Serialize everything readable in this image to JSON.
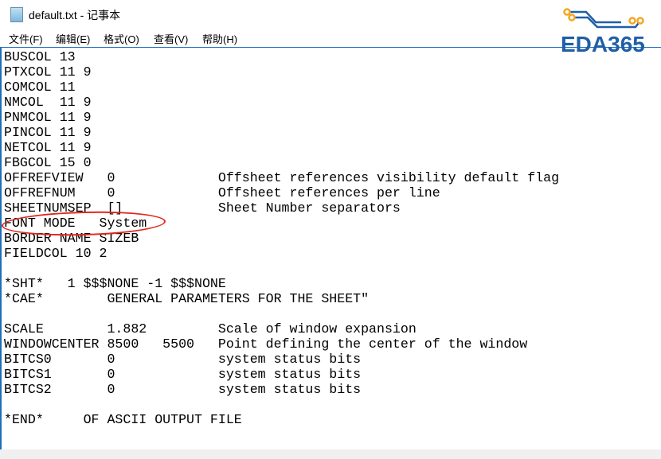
{
  "window": {
    "title": "default.txt - 记事本"
  },
  "menu": [
    "文件(F)",
    "编辑(E)",
    "格式(O)",
    "查看(V)",
    "帮助(H)"
  ],
  "logo": {
    "text": "EDA365",
    "accent": "#f5a623",
    "brand": "#1f5fa8"
  },
  "annotation_color": "#e0261d",
  "lines": [
    "BUSCOL 13",
    "PTXCOL 11 9",
    "COMCOL 11",
    "NMCOL  11 9",
    "PNMCOL 11 9",
    "PINCOL 11 9",
    "NETCOL 11 9",
    "FBGCOL 15 0",
    "OFFREFVIEW   0             Offsheet references visibility default flag",
    "OFFREFNUM    0             Offsheet references per line",
    "SHEETNUMSEP  []            Sheet Number separators",
    "FONT MODE   System",
    "BORDER NAME SIZEB",
    "FIELDCOL 10 2",
    "",
    "*SHT*   1 $$$NONE -1 $$$NONE",
    "*CAE*        GENERAL PARAMETERS FOR THE SHEET\"",
    "",
    "SCALE        1.882         Scale of window expansion",
    "WINDOWCENTER 8500   5500   Point defining the center of the window",
    "BITCS0       0             system status bits",
    "BITCS1       0             system status bits",
    "BITCS2       0             system status bits",
    "",
    "*END*     OF ASCII OUTPUT FILE"
  ]
}
